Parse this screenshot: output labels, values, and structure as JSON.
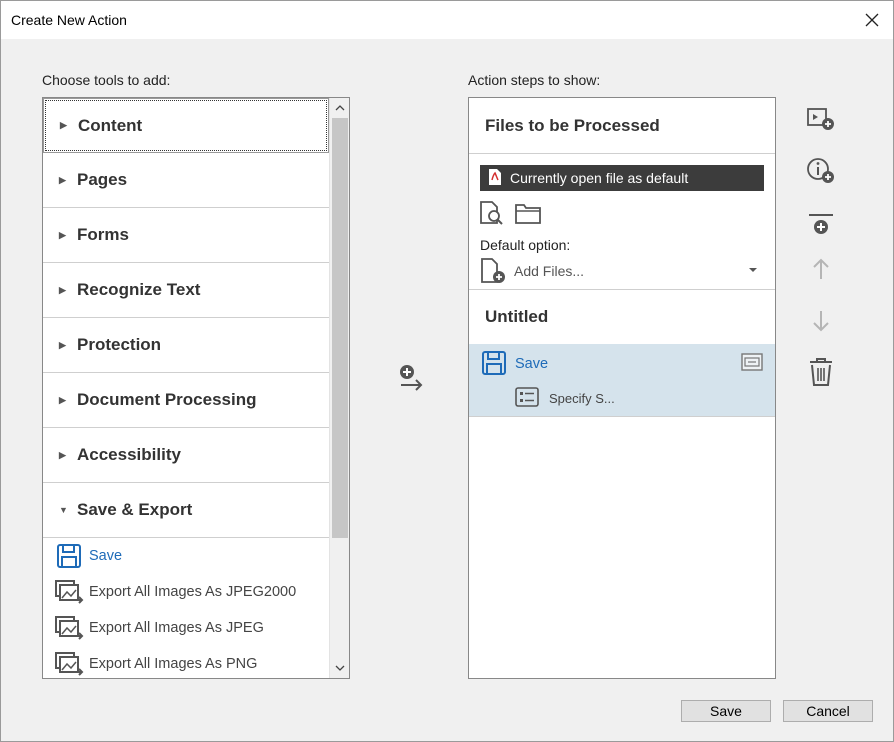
{
  "window": {
    "title": "Create New Action"
  },
  "left": {
    "label": "Choose tools to add:",
    "categories": [
      {
        "label": "Content",
        "expanded": false
      },
      {
        "label": "Pages",
        "expanded": false
      },
      {
        "label": "Forms",
        "expanded": false
      },
      {
        "label": "Recognize Text",
        "expanded": false
      },
      {
        "label": "Protection",
        "expanded": false
      },
      {
        "label": "Document Processing",
        "expanded": false
      },
      {
        "label": "Accessibility",
        "expanded": false
      },
      {
        "label": "Save & Export",
        "expanded": true
      }
    ],
    "tools": [
      {
        "label": "Save",
        "icon": "save-icon"
      },
      {
        "label": "Export All Images As JPEG2000",
        "icon": "export-images-icon"
      },
      {
        "label": "Export All Images As JPEG",
        "icon": "export-images-icon"
      },
      {
        "label": "Export All Images As PNG",
        "icon": "export-images-icon"
      }
    ]
  },
  "right": {
    "label": "Action steps to show:",
    "files_header": "Files to be Processed",
    "current_file": "Currently open file as default",
    "default_option_label": "Default option:",
    "add_files": "Add Files...",
    "untitled": "Untitled",
    "step_save": "Save",
    "step_specify": "Specify S..."
  },
  "buttons": {
    "save": "Save",
    "cancel": "Cancel"
  },
  "colors": {
    "accent": "#1e6bb8",
    "selected_row": "#d5e3ec",
    "file_box": "#3c3c3c"
  }
}
